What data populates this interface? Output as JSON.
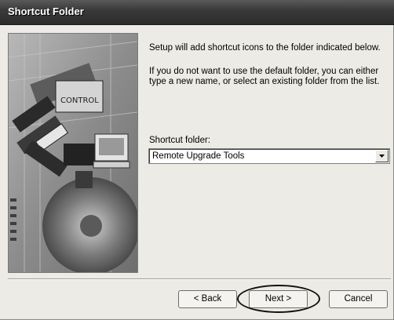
{
  "window": {
    "title": "Shortcut Folder"
  },
  "content": {
    "line1": "Setup will add shortcut icons to the folder indicated below.",
    "line2": "If you do not want to use the default folder, you can either",
    "line3": "type a new name, or select an existing folder from the list."
  },
  "shortcut_folder": {
    "label": "Shortcut folder:",
    "value": "Remote Upgrade Tools"
  },
  "buttons": {
    "back": "< Back",
    "next": "Next >",
    "cancel": "Cancel"
  }
}
